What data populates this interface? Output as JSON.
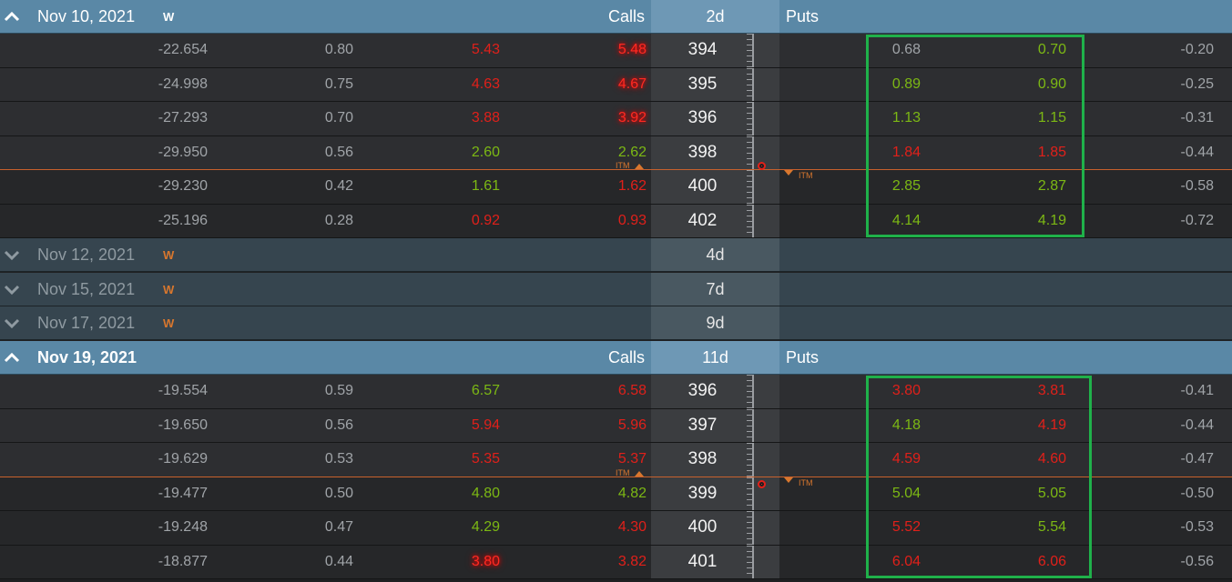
{
  "expirations": [
    {
      "date": "Nov 10, 2021",
      "week_tag": "W",
      "days": "2d",
      "expanded": true,
      "calls_label": "Calls",
      "puts_label": "Puts",
      "itm_label": "ITM",
      "rows": [
        {
          "c1": "-22.654",
          "c2": "0.80",
          "bid": "5.43",
          "ask": "5.48",
          "strike": "394",
          "pbid": "0.68",
          "pask": "0.70",
          "pdelta": "-0.20"
        },
        {
          "c1": "-24.998",
          "c2": "0.75",
          "bid": "4.63",
          "ask": "4.67",
          "strike": "395",
          "pbid": "0.89",
          "pask": "0.90",
          "pdelta": "-0.25"
        },
        {
          "c1": "-27.293",
          "c2": "0.70",
          "bid": "3.88",
          "ask": "3.92",
          "strike": "396",
          "pbid": "1.13",
          "pask": "1.15",
          "pdelta": "-0.31"
        },
        {
          "c1": "-29.950",
          "c2": "0.56",
          "bid": "2.60",
          "ask": "2.62",
          "strike": "398",
          "pbid": "1.84",
          "pask": "1.85",
          "pdelta": "-0.44"
        },
        {
          "c1": "-29.230",
          "c2": "0.42",
          "bid": "1.61",
          "ask": "1.62",
          "strike": "400",
          "pbid": "2.85",
          "pask": "2.87",
          "pdelta": "-0.58"
        },
        {
          "c1": "-25.196",
          "c2": "0.28",
          "bid": "0.92",
          "ask": "0.93",
          "strike": "402",
          "pbid": "4.14",
          "pask": "4.19",
          "pdelta": "-0.72"
        }
      ]
    },
    {
      "date": "Nov 12, 2021",
      "week_tag": "W",
      "days": "4d",
      "expanded": false
    },
    {
      "date": "Nov 15, 2021",
      "week_tag": "W",
      "days": "7d",
      "expanded": false
    },
    {
      "date": "Nov 17, 2021",
      "week_tag": "W",
      "days": "9d",
      "expanded": false
    },
    {
      "date": "Nov 19, 2021",
      "week_tag": "",
      "days": "11d",
      "expanded": true,
      "calls_label": "Calls",
      "puts_label": "Puts",
      "itm_label": "ITM",
      "rows": [
        {
          "c1": "-19.554",
          "c2": "0.59",
          "bid": "6.57",
          "ask": "6.58",
          "strike": "396",
          "pbid": "3.80",
          "pask": "3.81",
          "pdelta": "-0.41"
        },
        {
          "c1": "-19.650",
          "c2": "0.56",
          "bid": "5.94",
          "ask": "5.96",
          "strike": "397",
          "pbid": "4.18",
          "pask": "4.19",
          "pdelta": "-0.44"
        },
        {
          "c1": "-19.629",
          "c2": "0.53",
          "bid": "5.35",
          "ask": "5.37",
          "strike": "398",
          "pbid": "4.59",
          "pask": "4.60",
          "pdelta": "-0.47"
        },
        {
          "c1": "-19.477",
          "c2": "0.50",
          "bid": "4.80",
          "ask": "4.82",
          "strike": "399",
          "pbid": "5.04",
          "pask": "5.05",
          "pdelta": "-0.50"
        },
        {
          "c1": "-19.248",
          "c2": "0.47",
          "bid": "4.29",
          "ask": "4.30",
          "strike": "400",
          "pbid": "5.52",
          "pask": "5.54",
          "pdelta": "-0.53"
        },
        {
          "c1": "-18.877",
          "c2": "0.44",
          "bid": "3.80",
          "ask": "3.82",
          "strike": "401",
          "pbid": "6.04",
          "pask": "6.06",
          "pdelta": "-0.56"
        }
      ]
    }
  ],
  "colors": {
    "up": "#7cb814",
    "down": "#e0201a",
    "neutral": "#a0a4a8",
    "header_bg": "#5a88a6",
    "collapsed_bg": "#36454f",
    "itm_line": "#c8612d",
    "highlight_box": "#1fb14a"
  },
  "value_colors": {
    "0": {
      "bid": [
        "rd",
        "rd",
        "rd",
        "g",
        "g",
        "rd"
      ],
      "ask": [
        "rd-hl",
        "rd-hl",
        "rd-hl",
        "g",
        "rd",
        "rd"
      ],
      "pbid": [
        "gy",
        "g",
        "g",
        "rd",
        "g",
        "g"
      ],
      "pask": [
        "g",
        "g",
        "g",
        "rd",
        "g",
        "g"
      ]
    },
    "4": {
      "bid": [
        "g",
        "rd",
        "rd",
        "g",
        "g",
        "rd-hl"
      ],
      "ask": [
        "rd",
        "rd",
        "rd",
        "g",
        "rd",
        "rd"
      ],
      "pbid": [
        "rd",
        "g",
        "rd",
        "g",
        "rd",
        "rd"
      ],
      "pask": [
        "rd",
        "rd",
        "rd",
        "g",
        "g",
        "rd"
      ]
    }
  }
}
